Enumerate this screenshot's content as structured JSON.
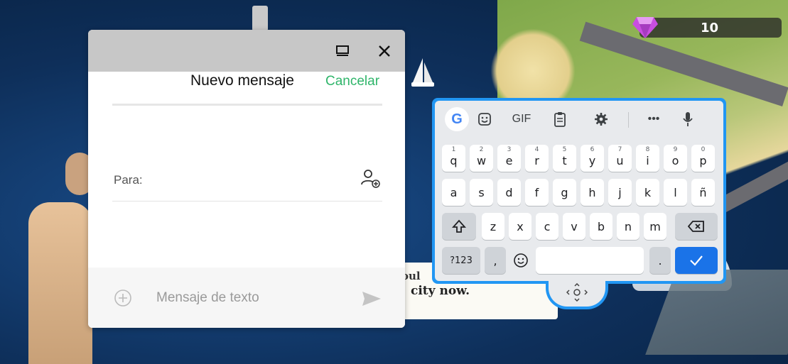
{
  "hud": {
    "gem_count": "10"
  },
  "game": {
    "speech_line1": "oul",
    "speech_line2": "city now."
  },
  "dialog": {
    "title": "Nuevo mensaje",
    "cancel_label": "Cancelar",
    "to_label": "Para:",
    "compose_placeholder": "Mensaje de texto",
    "icons": {
      "restore": "window-restore-icon",
      "close": "close-icon",
      "add_contact": "add-contact-icon",
      "attach": "add-circle-icon",
      "send": "send-icon"
    }
  },
  "keyboard": {
    "toolbar": {
      "google": "G",
      "gif": "GIF",
      "more": "•••"
    },
    "row1": [
      {
        "label": "q",
        "hint": "1"
      },
      {
        "label": "w",
        "hint": "2"
      },
      {
        "label": "e",
        "hint": "3"
      },
      {
        "label": "r",
        "hint": "4"
      },
      {
        "label": "t",
        "hint": "5"
      },
      {
        "label": "y",
        "hint": "6"
      },
      {
        "label": "u",
        "hint": "7"
      },
      {
        "label": "i",
        "hint": "8"
      },
      {
        "label": "o",
        "hint": "9"
      },
      {
        "label": "p",
        "hint": "0"
      }
    ],
    "row2": [
      "a",
      "s",
      "d",
      "f",
      "g",
      "h",
      "j",
      "k",
      "l",
      "ñ"
    ],
    "row3": [
      "z",
      "x",
      "c",
      "v",
      "b",
      "n",
      "m"
    ],
    "row4": {
      "symbols": "?123",
      "comma": ",",
      "period": "."
    },
    "colors": {
      "accent": "#2196f3",
      "enter": "#1a73e8",
      "background": "#e8eaed"
    }
  }
}
